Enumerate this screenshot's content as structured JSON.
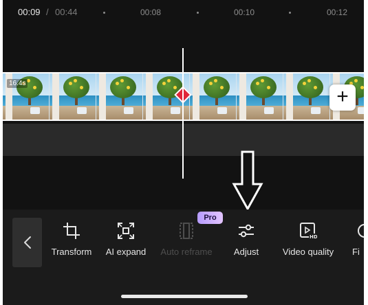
{
  "timeline": {
    "current_time": "00:09",
    "separator": "/",
    "total_time": "00:44",
    "ticks": [
      "00:08",
      "00:10",
      "00:12"
    ],
    "clip_duration": "16.4s"
  },
  "toolbar": {
    "pro_badge": "Pro",
    "tools": [
      {
        "label": "Transform",
        "icon": "crop-icon",
        "enabled": true
      },
      {
        "label": "AI expand",
        "icon": "expand-icon",
        "enabled": true
      },
      {
        "label": "Auto reframe",
        "icon": "reframe-icon",
        "enabled": false
      },
      {
        "label": "Adjust",
        "icon": "sliders-icon",
        "enabled": true
      },
      {
        "label": "Video quality",
        "icon": "video-hd-icon",
        "enabled": true
      },
      {
        "label": "Fi",
        "icon": "",
        "enabled": true
      }
    ]
  },
  "colors": {
    "background": "#121212",
    "toolbar": "#1b1b1b",
    "keyframe": "#e0263a",
    "pro_badge": "#c9b0ff"
  }
}
